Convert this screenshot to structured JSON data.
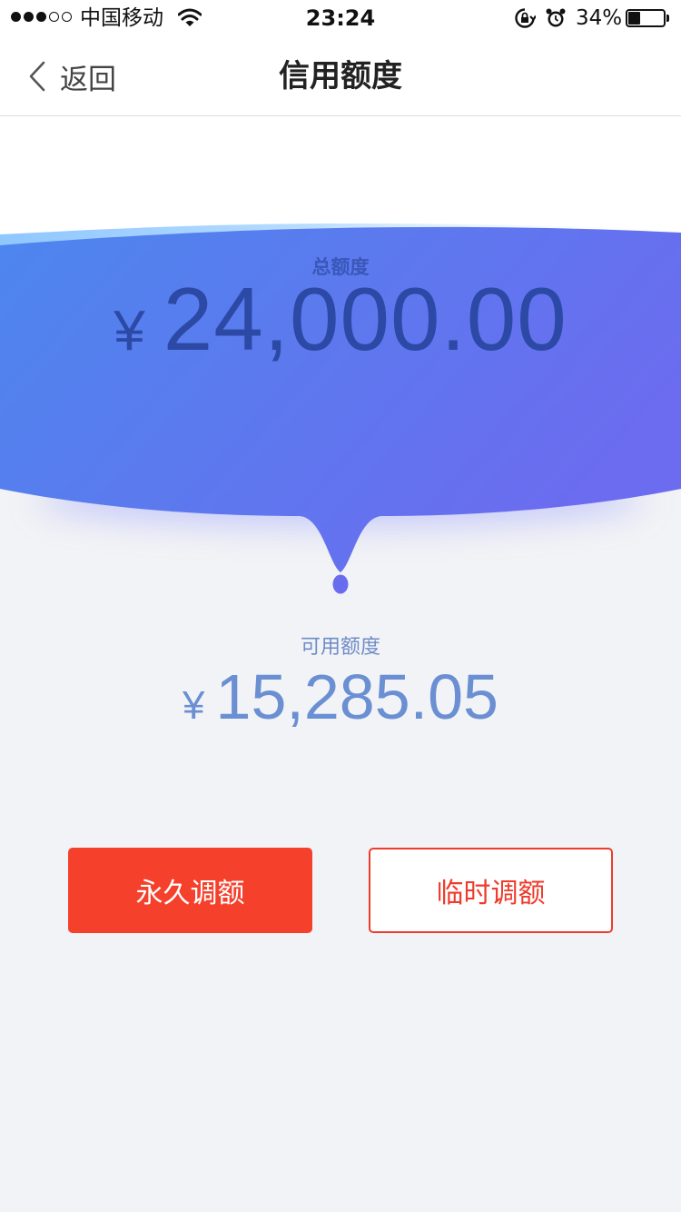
{
  "status_bar": {
    "carrier": "中国移动",
    "time": "23:24",
    "battery_percent": "34%",
    "battery_level": 0.34,
    "signal_bars_filled": 3,
    "signal_bars_total": 5,
    "icons": [
      "wifi-icon",
      "rotation-lock-icon",
      "alarm-icon",
      "battery-icon"
    ]
  },
  "nav": {
    "back_label": "返回",
    "title": "信用额度"
  },
  "credit": {
    "total_label": "总额度",
    "currency_symbol": "¥",
    "total_amount": "24,000.00",
    "available_label": "可用额度",
    "available_amount": "15,285.05"
  },
  "actions": {
    "permanent_adjust_label": "永久调额",
    "temporary_adjust_label": "临时调额"
  },
  "colors": {
    "primary_red": "#f5402c",
    "blob_gradient_start": "#4d86ee",
    "blob_gradient_end": "#6b6cef",
    "amount_text_dark": "#2d49a6",
    "amount_text_light": "#6b8fd3"
  }
}
